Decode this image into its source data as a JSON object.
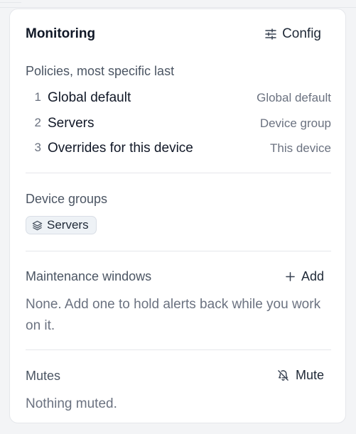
{
  "card": {
    "title": "Monitoring",
    "config_label": "Config"
  },
  "policies": {
    "label": "Policies, most specific last",
    "items": [
      {
        "num": "1",
        "name": "Global default",
        "scope": "Global default"
      },
      {
        "num": "2",
        "name": "Servers",
        "scope": "Device group"
      },
      {
        "num": "3",
        "name": "Overrides for this device",
        "scope": "This device"
      }
    ]
  },
  "device_groups": {
    "label": "Device groups",
    "chips": [
      {
        "label": "Servers",
        "icon": "layers-icon"
      }
    ]
  },
  "maintenance": {
    "label": "Maintenance windows",
    "add_label": "Add",
    "empty_text": "None. Add one to hold alerts back while you work on it."
  },
  "mutes": {
    "label": "Mutes",
    "mute_label": "Mute",
    "empty_text": "Nothing muted."
  },
  "icons": {
    "config": "sliders-icon",
    "add": "plus-icon",
    "mute": "bell-off-icon"
  },
  "colors": {
    "text_primary": "#111827",
    "text_muted": "#6b7280",
    "border": "#e5e7eb",
    "chip_bg": "#eef2f6"
  }
}
